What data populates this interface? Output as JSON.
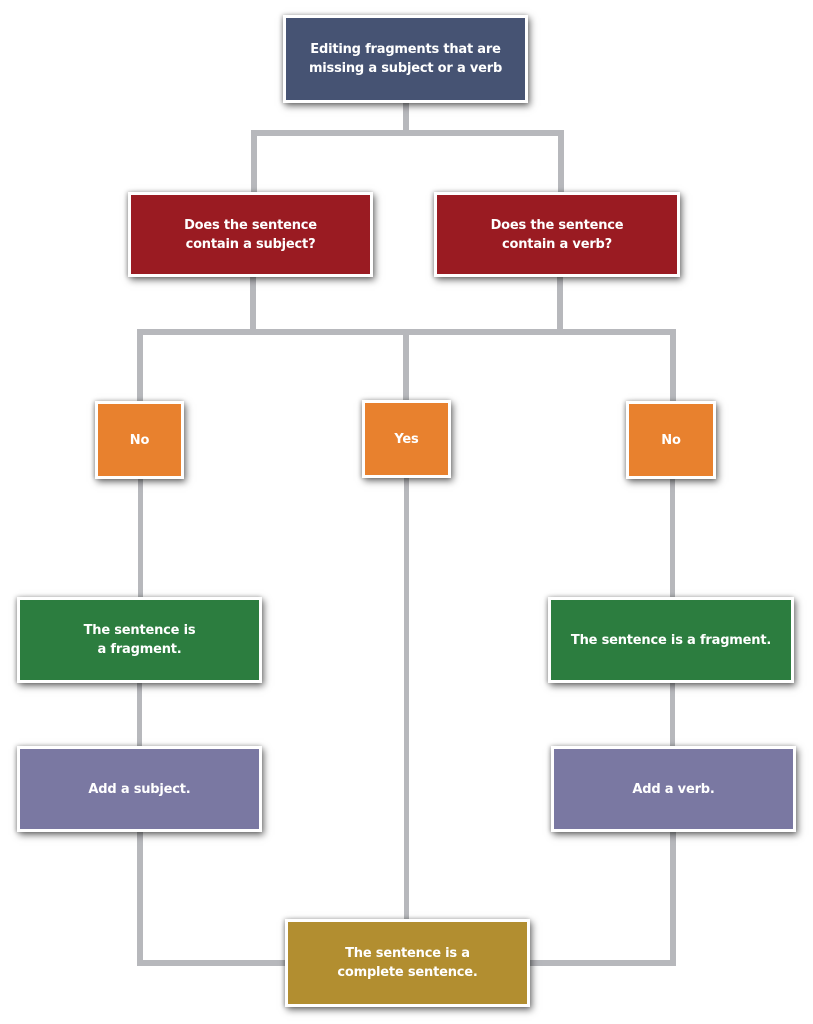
{
  "diagram": {
    "type": "flowchart",
    "title": "Editing fragments that are missing a subject or a verb",
    "colors": {
      "title_box": "#465373",
      "question_box": "#9a1b22",
      "answer_box": "#e8812e",
      "fragment_box": "#2c7d3f",
      "action_box": "#7a78a2",
      "result_box": "#b28e30",
      "connector": "#b7b8bc",
      "text": "#ffffff"
    },
    "nodes": {
      "root": {
        "label": "Editing fragments that are\nmissing a subject or a verb"
      },
      "q_subject": {
        "label": "Does the sentence\ncontain a subject?"
      },
      "q_verb": {
        "label": "Does the sentence\ncontain a verb?"
      },
      "no_subject": {
        "label": "No"
      },
      "yes": {
        "label": "Yes"
      },
      "no_verb": {
        "label": "No"
      },
      "fragment_left": {
        "label": "The sentence is\na fragment."
      },
      "fragment_right": {
        "label": "The sentence is a fragment."
      },
      "add_subject": {
        "label": "Add a subject."
      },
      "add_verb": {
        "label": "Add a verb."
      },
      "complete": {
        "label": "The sentence is a\ncomplete sentence."
      }
    },
    "edges": [
      [
        "root",
        "q_subject"
      ],
      [
        "root",
        "q_verb"
      ],
      [
        "q_subject",
        "no_subject"
      ],
      [
        "q_subject",
        "yes"
      ],
      [
        "q_subject",
        "no_verb"
      ],
      [
        "q_verb",
        "no_subject"
      ],
      [
        "q_verb",
        "yes"
      ],
      [
        "q_verb",
        "no_verb"
      ],
      [
        "no_subject",
        "fragment_left"
      ],
      [
        "fragment_left",
        "add_subject"
      ],
      [
        "add_subject",
        "complete"
      ],
      [
        "yes",
        "complete"
      ],
      [
        "no_verb",
        "fragment_right"
      ],
      [
        "fragment_right",
        "add_verb"
      ],
      [
        "add_verb",
        "complete"
      ]
    ]
  }
}
